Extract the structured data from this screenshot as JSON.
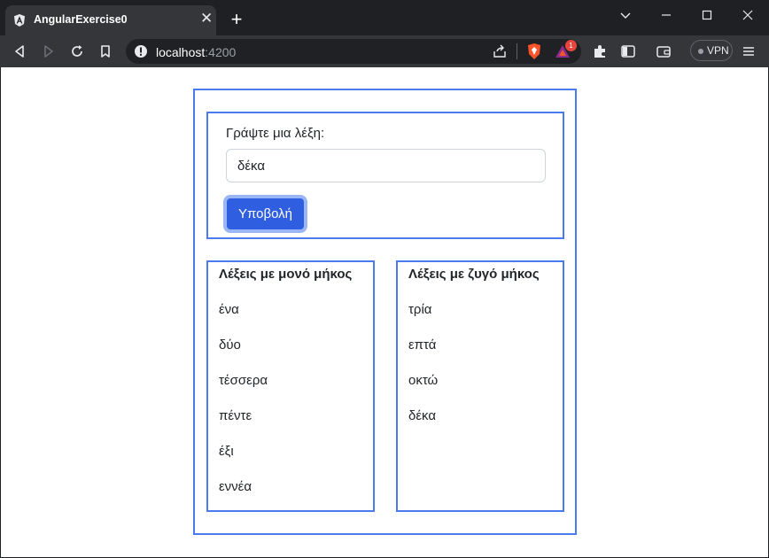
{
  "browser": {
    "tab_title": "AngularExercise0",
    "url_host": "localhost",
    "url_port": ":4200",
    "vpn_label": "VPN",
    "notification_count": "1"
  },
  "form": {
    "label": "Γράψτε μια λέξη:",
    "input_value": "δέκα",
    "submit_label": "Υποβολή"
  },
  "odd_list": {
    "title": "Λέξεις με μονό μήκος",
    "items": [
      "ένα",
      "δύο",
      "τέσσερα",
      "πέντε",
      "έξι",
      "εννέα"
    ]
  },
  "even_list": {
    "title": "Λέξεις με ζυγό μήκος",
    "items": [
      "τρία",
      "επτά",
      "οκτώ",
      "δέκα"
    ]
  },
  "colors": {
    "accent": "#4a7af0",
    "button": "#2f5fe0",
    "chrome_dark": "#1f2023",
    "chrome_toolbar": "#35363a"
  }
}
